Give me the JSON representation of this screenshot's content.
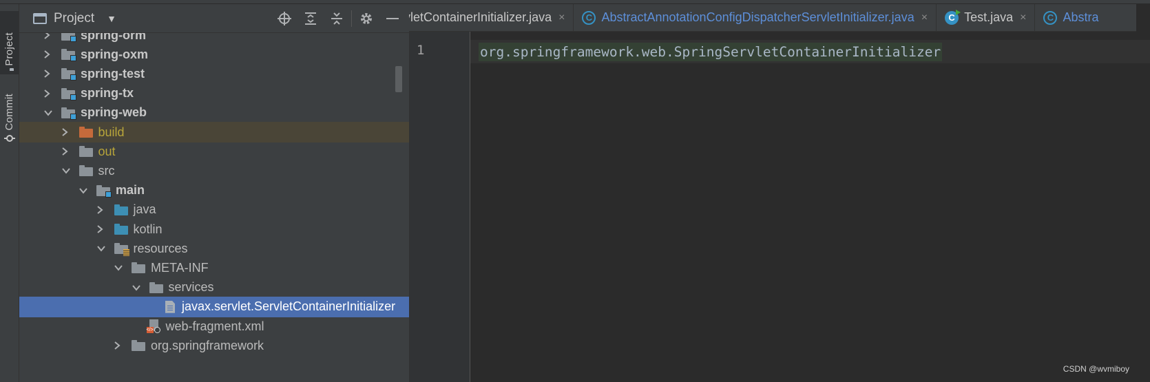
{
  "left_stripe": {
    "project_label": "Project",
    "commit_label": "Commit"
  },
  "project_panel": {
    "title": "Project",
    "tools": {
      "locate": "⊕",
      "expand": "⇕",
      "collapse": "⇔",
      "settings": "⚙",
      "hide": "—"
    },
    "tree": [
      {
        "label": "spring-orm",
        "style": "bold",
        "icon": "module-folder",
        "chevron": "right",
        "indent": 0
      },
      {
        "label": "spring-oxm",
        "style": "bold",
        "icon": "module-folder",
        "chevron": "right",
        "indent": 0
      },
      {
        "label": "spring-test",
        "style": "bold",
        "icon": "module-folder",
        "chevron": "right",
        "indent": 0
      },
      {
        "label": "spring-tx",
        "style": "bold",
        "icon": "module-folder",
        "chevron": "right",
        "indent": 0
      },
      {
        "label": "spring-web",
        "style": "bold",
        "icon": "module-folder",
        "chevron": "down",
        "indent": 0
      },
      {
        "label": "build",
        "style": "olive",
        "icon": "excluded-folder",
        "chevron": "right",
        "indent": 1
      },
      {
        "label": "out",
        "style": "olive",
        "icon": "folder",
        "chevron": "right",
        "indent": 1
      },
      {
        "label": "src",
        "style": "normal",
        "icon": "folder",
        "chevron": "down",
        "indent": 1
      },
      {
        "label": "main",
        "style": "bold",
        "icon": "module-folder",
        "chevron": "down",
        "indent": 2
      },
      {
        "label": "java",
        "style": "normal",
        "icon": "source-folder",
        "chevron": "right",
        "indent": 3
      },
      {
        "label": "kotlin",
        "style": "normal",
        "icon": "source-folder",
        "chevron": "right",
        "indent": 3
      },
      {
        "label": "resources",
        "style": "normal",
        "icon": "resources-folder",
        "chevron": "down",
        "indent": 3
      },
      {
        "label": "META-INF",
        "style": "normal",
        "icon": "folder",
        "chevron": "down",
        "indent": 4
      },
      {
        "label": "services",
        "style": "normal",
        "icon": "folder",
        "chevron": "down",
        "indent": 5
      },
      {
        "label": "javax.servlet.ServletContainerInitializer",
        "style": "selected",
        "icon": "text-file",
        "chevron": "none",
        "indent": 6
      },
      {
        "label": "web-fragment.xml",
        "style": "normal",
        "icon": "xml-file",
        "chevron": "none",
        "indent": 5
      },
      {
        "label": "org.springframework",
        "style": "normal",
        "icon": "folder",
        "chevron": "right",
        "indent": 4
      }
    ]
  },
  "editor": {
    "tabs": [
      {
        "label": "vletContainerInitializer.java",
        "icon": "none",
        "style": "normal"
      },
      {
        "label": "AbstractAnnotationConfigDispatcherServletInitializer.java",
        "icon": "abstract-class-icon",
        "style": "link"
      },
      {
        "label": "Test.java",
        "icon": "runnable-class-icon",
        "style": "normal"
      },
      {
        "label": "Abstra",
        "icon": "abstract-class-icon",
        "style": "link"
      }
    ],
    "close_glyph": "×",
    "line_number": "1",
    "code": "org.springframework.web.SpringServletContainerInitializer"
  },
  "watermark": "CSDN @wvmiboy"
}
